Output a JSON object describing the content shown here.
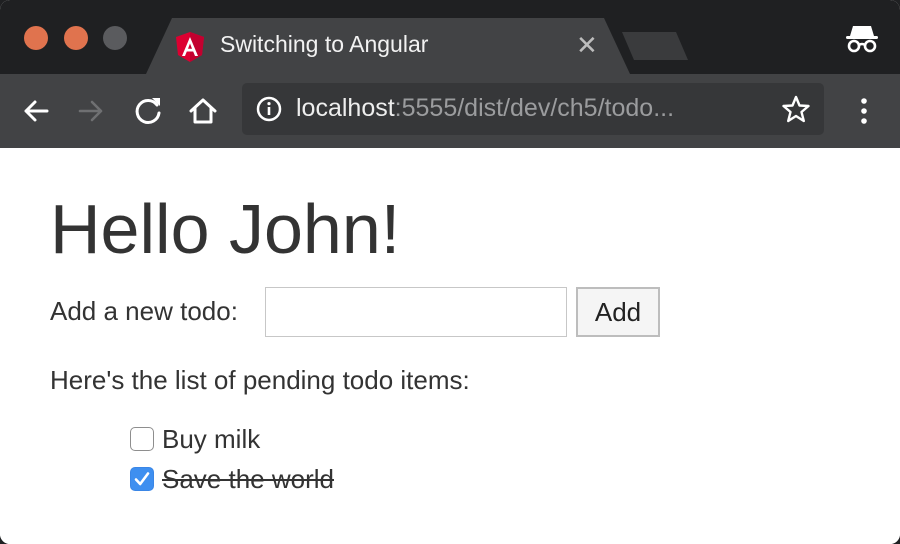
{
  "browser": {
    "tab": {
      "title": "Switching to Angular",
      "favicon": "angular-shield-icon"
    },
    "address_bar": {
      "host": "localhost",
      "rest": ":5555/dist/dev/ch5/todo..."
    },
    "icons": [
      "back-arrow-icon",
      "forward-arrow-icon",
      "reload-icon",
      "home-icon",
      "info-icon",
      "star-icon",
      "menu-dots-icon",
      "incognito-icon",
      "close-icon"
    ],
    "colors": {
      "chrome_dark": "#1f2022",
      "toolbar": "#424345",
      "traffic_light": "#e0734e",
      "angular_red": "#dd0031"
    }
  },
  "page": {
    "heading": "Hello John!",
    "add_label": "Add a new todo:",
    "input": {
      "value": "",
      "placeholder": ""
    },
    "add_button": "Add",
    "pending_text": "Here's the list of pending todo items:",
    "todos": [
      {
        "label": "Buy milk",
        "completed": false
      },
      {
        "label": "Save the world",
        "completed": true
      }
    ],
    "colors": {
      "text": "#333333",
      "checkbox_checked": "#3e8ff0"
    }
  }
}
